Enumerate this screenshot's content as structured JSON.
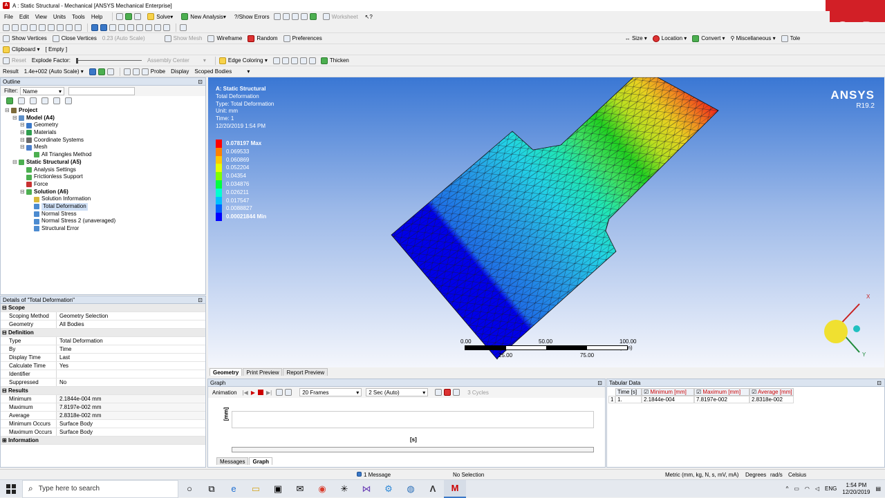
{
  "window": {
    "title": "A : Static Structural - Mechanical [ANSYS Mechanical Enterprise]"
  },
  "menu": [
    "File",
    "Edit",
    "View",
    "Units",
    "Tools",
    "Help"
  ],
  "toolbar1": {
    "solve": "Solve",
    "new_analysis": "New Analysis",
    "show_errors": "Show Errors",
    "worksheet": "Worksheet"
  },
  "toolbar3": {
    "show_vertices": "Show Vertices",
    "close_vertices": "Close Vertices",
    "auto_scale": "0.23 (Auto Scale)",
    "show_mesh": "Show Mesh",
    "wireframe": "Wireframe",
    "random": "Random",
    "preferences": "Preferences",
    "size": "Size",
    "location": "Location",
    "convert": "Convert",
    "misc": "Miscellaneous",
    "tolerance": "Tole"
  },
  "toolbar4": {
    "clipboard": "Clipboard",
    "empty": "[ Empty ]"
  },
  "toolbar5": {
    "reset": "Reset",
    "explode": "Explode Factor:",
    "assembly_center": "Assembly Center",
    "edge_coloring": "Edge Coloring",
    "thicken": "Thicken"
  },
  "toolbar6": {
    "result": "Result",
    "scale": "1.4e+002 (Auto Scale)",
    "probe": "Probe",
    "display": "Display",
    "scoped": "Scoped Bodies"
  },
  "outline": {
    "header": "Outline",
    "filter_label": "Filter:",
    "filter_value": "Name",
    "nodes": [
      {
        "label": "Project",
        "indent": 0,
        "bold": true,
        "icon": "#7d6b3a"
      },
      {
        "label": "Model (A4)",
        "indent": 1,
        "bold": true,
        "icon": "#5d8fc8"
      },
      {
        "label": "Geometry",
        "indent": 2,
        "bold": false,
        "icon": "#3a78c8"
      },
      {
        "label": "Materials",
        "indent": 2,
        "bold": false,
        "icon": "#2e9e4e"
      },
      {
        "label": "Coordinate Systems",
        "indent": 2,
        "bold": false,
        "icon": "#6b6b6b"
      },
      {
        "label": "Mesh",
        "indent": 2,
        "bold": false,
        "icon": "#4a7fcc"
      },
      {
        "label": "All Triangles Method",
        "indent": 3,
        "bold": false,
        "icon": "#4caf50"
      },
      {
        "label": "Static Structural (A5)",
        "indent": 1,
        "bold": true,
        "icon": "#4caf50"
      },
      {
        "label": "Analysis Settings",
        "indent": 2,
        "bold": false,
        "icon": "#4caf50"
      },
      {
        "label": "Frictionless Support",
        "indent": 2,
        "bold": false,
        "icon": "#4caf50"
      },
      {
        "label": "Force",
        "indent": 2,
        "bold": false,
        "icon": "#c83232"
      },
      {
        "label": "Solution (A6)",
        "indent": 2,
        "bold": true,
        "icon": "#4caf50"
      },
      {
        "label": "Solution Information",
        "indent": 3,
        "bold": false,
        "icon": "#d9b93a"
      },
      {
        "label": "Total Deformation",
        "indent": 3,
        "bold": false,
        "icon": "#4c8bd0",
        "selected": true
      },
      {
        "label": "Normal Stress",
        "indent": 3,
        "bold": false,
        "icon": "#4c8bd0"
      },
      {
        "label": "Normal Stress 2 (unaveraged)",
        "indent": 3,
        "bold": false,
        "icon": "#4c8bd0"
      },
      {
        "label": "Structural Error",
        "indent": 3,
        "bold": false,
        "icon": "#4c8bd0"
      }
    ]
  },
  "details": {
    "header": "Details of \"Total Deformation\"",
    "rows": [
      {
        "k": "Scope",
        "sec": true
      },
      {
        "k": "Scoping Method",
        "v": "Geometry Selection"
      },
      {
        "k": "Geometry",
        "v": "All Bodies"
      },
      {
        "k": "Definition",
        "sec": true
      },
      {
        "k": "Type",
        "v": "Total Deformation"
      },
      {
        "k": "By",
        "v": "Time"
      },
      {
        "k": "Display Time",
        "v": "Last"
      },
      {
        "k": "Calculate Time History",
        "v": "Yes"
      },
      {
        "k": "Identifier",
        "v": ""
      },
      {
        "k": "Suppressed",
        "v": "No"
      },
      {
        "k": "Results",
        "sec": true
      },
      {
        "k": "Minimum",
        "v": "2.1844e-004 mm",
        "sh": true
      },
      {
        "k": "Maximum",
        "v": "7.8197e-002 mm",
        "sh": true
      },
      {
        "k": "Average",
        "v": "2.8318e-002 mm",
        "sh": true
      },
      {
        "k": "Minimum Occurs On",
        "v": "Surface Body"
      },
      {
        "k": "Maximum Occurs On",
        "v": "Surface Body"
      },
      {
        "k": "Information",
        "sec": true
      }
    ]
  },
  "viewport": {
    "info": [
      "A: Static Structural",
      "Total Deformation",
      "Type: Total Deformation",
      "Unit: mm",
      "Time: 1",
      "12/20/2019 1:54 PM"
    ],
    "legend_labels": [
      "0.078197 Max",
      "0.069533",
      "0.060869",
      "0.052204",
      "0.04354",
      "0.034876",
      "0.026211",
      "0.017547",
      "0.0088827",
      "0.00021844 Min"
    ],
    "legend_colors": [
      "#ff0000",
      "#ff8000",
      "#ffc800",
      "#e6ff00",
      "#80ff00",
      "#00ff40",
      "#00ffd0",
      "#00c0ff",
      "#0060ff",
      "#0000ff"
    ],
    "brand": "ANSYS",
    "version": "R19.2",
    "scale_labels_top": [
      "0.00",
      "50.00",
      "100.00 (mm)"
    ],
    "scale_labels_bottom": [
      "25.00",
      "75.00"
    ],
    "axis_x": "X",
    "axis_y": "Y"
  },
  "view_tabs": [
    "Geometry",
    "Print Preview",
    "Report Preview"
  ],
  "graph": {
    "header": "Graph",
    "animation": "Animation",
    "frames": "20 Frames",
    "duration": "2 Sec (Auto)",
    "cycles": "3 Cycles",
    "y_unit": "[mm]",
    "x_unit": "[s]",
    "tabs": [
      "Messages",
      "Graph"
    ]
  },
  "tabular": {
    "header": "Tabular Data",
    "columns": [
      "Time [s]",
      "Minimum [mm]",
      "Maximum [mm]",
      "Average [mm]"
    ],
    "rows": [
      [
        "1",
        "1.",
        "2.1844e-004",
        "7.8197e-002",
        "2.8318e-002"
      ]
    ]
  },
  "status": {
    "messages": "1 Message",
    "selection": "No Selection",
    "units": "Metric (mm, kg, N, s, mV, mA)",
    "degrees": "Degrees",
    "rad": "rad/s",
    "temp": "Celsius"
  },
  "taskbar": {
    "search_placeholder": "Type here to search",
    "lang": "ENG",
    "time": "1:54 PM",
    "date": "12/20/2019"
  }
}
